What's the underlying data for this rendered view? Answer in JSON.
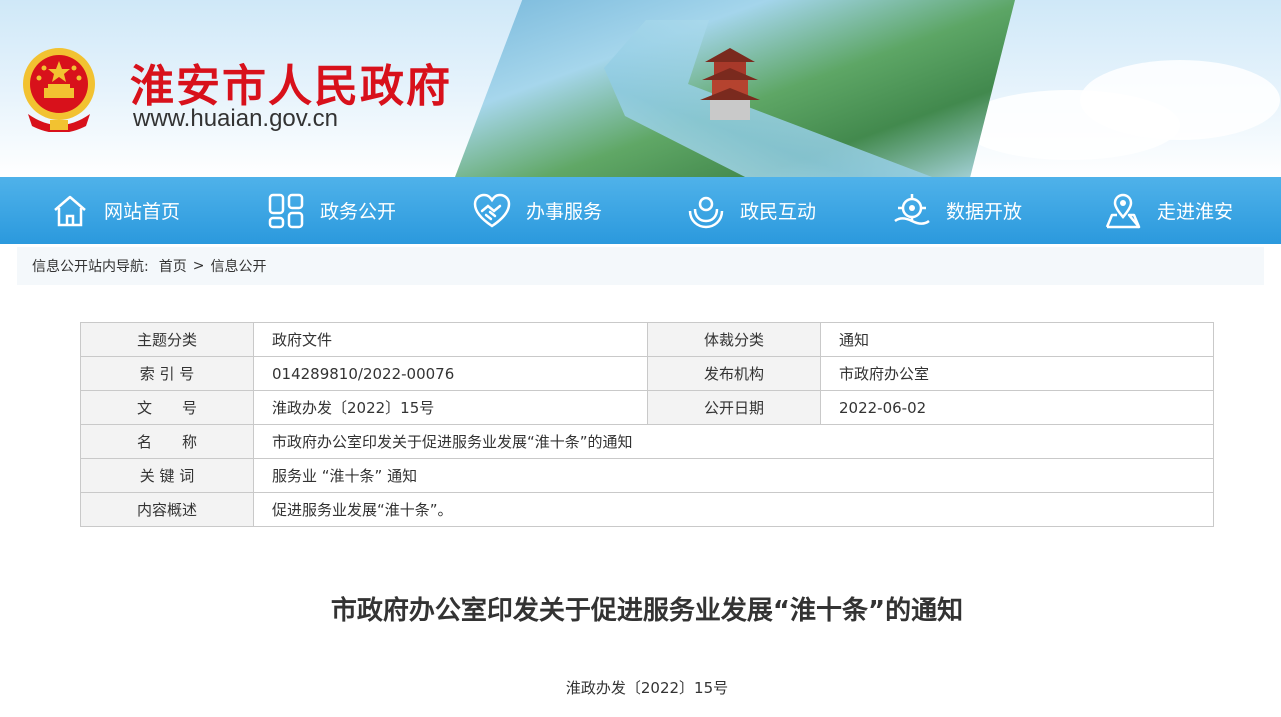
{
  "header": {
    "site_title": "淮安市人民政府",
    "site_url": "www.huaian.gov.cn",
    "brand_color": "#d8111b"
  },
  "nav": {
    "items": [
      {
        "label": "网站首页",
        "icon": "home-icon"
      },
      {
        "label": "政务公开",
        "icon": "grid-icon"
      },
      {
        "label": "办事服务",
        "icon": "handshake-icon"
      },
      {
        "label": "政民互动",
        "icon": "hands-icon"
      },
      {
        "label": "数据开放",
        "icon": "data-icon"
      },
      {
        "label": "走进淮安",
        "icon": "map-pin-icon"
      }
    ],
    "bg_color": "#2b99dd"
  },
  "breadcrumb": {
    "prefix": "信息公开站内导航:",
    "items": [
      "首页",
      "信息公开"
    ],
    "separator": ">"
  },
  "info": {
    "rows": [
      {
        "k1": "主题分类",
        "v1": "政府文件",
        "k2": "体裁分类",
        "v2": "通知"
      },
      {
        "k1": "索 引 号",
        "v1": "014289810/2022-00076",
        "k2": "发布机构",
        "v2": "市政府办公室"
      },
      {
        "k1": "文　　号",
        "v1": "淮政办发〔2022〕15号",
        "k2": "公开日期",
        "v2": "2022-06-02"
      }
    ],
    "wide_rows": [
      {
        "k": "名　　称",
        "v": "市政府办公室印发关于促进服务业发展“淮十条”的通知"
      },
      {
        "k": "关 键 词",
        "v": "服务业 “淮十条” 通知"
      },
      {
        "k": "内容概述",
        "v": "促进服务业发展“淮十条”。"
      }
    ]
  },
  "article": {
    "title": "市政府办公室印发关于促进服务业发展“淮十条”的通知",
    "doc_number": "淮政办发〔2022〕15号"
  }
}
